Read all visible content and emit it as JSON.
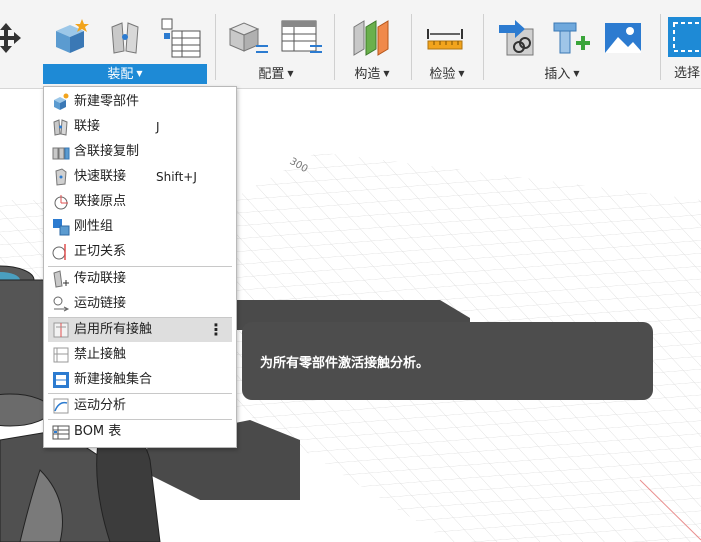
{
  "toolbar": {
    "groups": [
      {
        "label": "装配",
        "active": true
      },
      {
        "label": "配置"
      },
      {
        "label": "构造"
      },
      {
        "label": "检验"
      },
      {
        "label": "插入"
      },
      {
        "label": "选择"
      }
    ]
  },
  "viewport": {
    "ruler_label": "300"
  },
  "assemble_menu": {
    "items": [
      {
        "label": "新建零部件",
        "shortcut": ""
      },
      {
        "label": "联接",
        "shortcut": "J"
      },
      {
        "label": "含联接复制",
        "shortcut": ""
      },
      {
        "label": "快速联接",
        "shortcut": "Shift+J"
      },
      {
        "label": "联接原点",
        "shortcut": ""
      },
      {
        "label": "刚性组",
        "shortcut": ""
      },
      {
        "label": "正切关系",
        "shortcut": ""
      },
      {
        "label": "传动联接",
        "shortcut": ""
      },
      {
        "label": "运动链接",
        "shortcut": ""
      },
      {
        "label": "启用所有接触",
        "shortcut": "",
        "highlighted": true,
        "more": "⋮"
      },
      {
        "label": "禁止接触",
        "shortcut": ""
      },
      {
        "label": "新建接触集合",
        "shortcut": ""
      },
      {
        "label": "运动分析",
        "shortcut": ""
      },
      {
        "label": "BOM 表",
        "shortcut": ""
      }
    ]
  },
  "tooltip": {
    "text": "为所有零部件激活接触分析。"
  },
  "colors": {
    "accent": "#1e8ad6",
    "tooltip_bg": "#4d4d4d",
    "highlight": "#dedede"
  }
}
